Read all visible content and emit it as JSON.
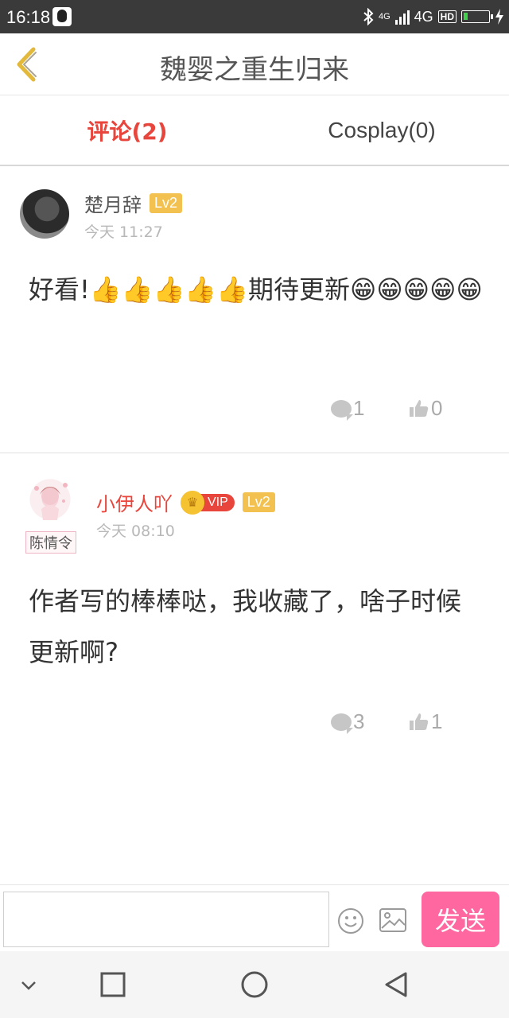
{
  "status_bar": {
    "time": "16:18",
    "network": "4G",
    "hd": "HD",
    "net_small": "4G"
  },
  "header": {
    "title": "魏婴之重生归来"
  },
  "tabs": [
    {
      "label": "评论(2)",
      "active": true
    },
    {
      "label": "Cosplay(0)",
      "active": false
    }
  ],
  "comments": [
    {
      "user": "楚月辞",
      "level": "Lv2",
      "time": "今天 11:27",
      "text": "好看!👍👍👍👍👍期待更新😁😁😁😁😁",
      "replies": "1",
      "likes": "0"
    },
    {
      "user": "小伊人吖",
      "vip": "VIP",
      "level": "Lv2",
      "avatar_tag": "陈情令",
      "time": "今天 08:10",
      "text": "作者写的棒棒哒，我收藏了，啥子时候更新啊?",
      "replies": "3",
      "likes": "1"
    }
  ],
  "input_bar": {
    "send_label": "发送"
  },
  "colors": {
    "accent_red": "#e8453c",
    "send_pink": "#ff67a1",
    "level_badge": "#f3c14f",
    "back_arrow": "#e2b93b"
  },
  "icons": {
    "back": "chevron-left-icon",
    "reply": "speech-bubble-icon",
    "like": "thumbs-up-icon",
    "emoji": "smiley-icon",
    "image": "image-icon"
  }
}
